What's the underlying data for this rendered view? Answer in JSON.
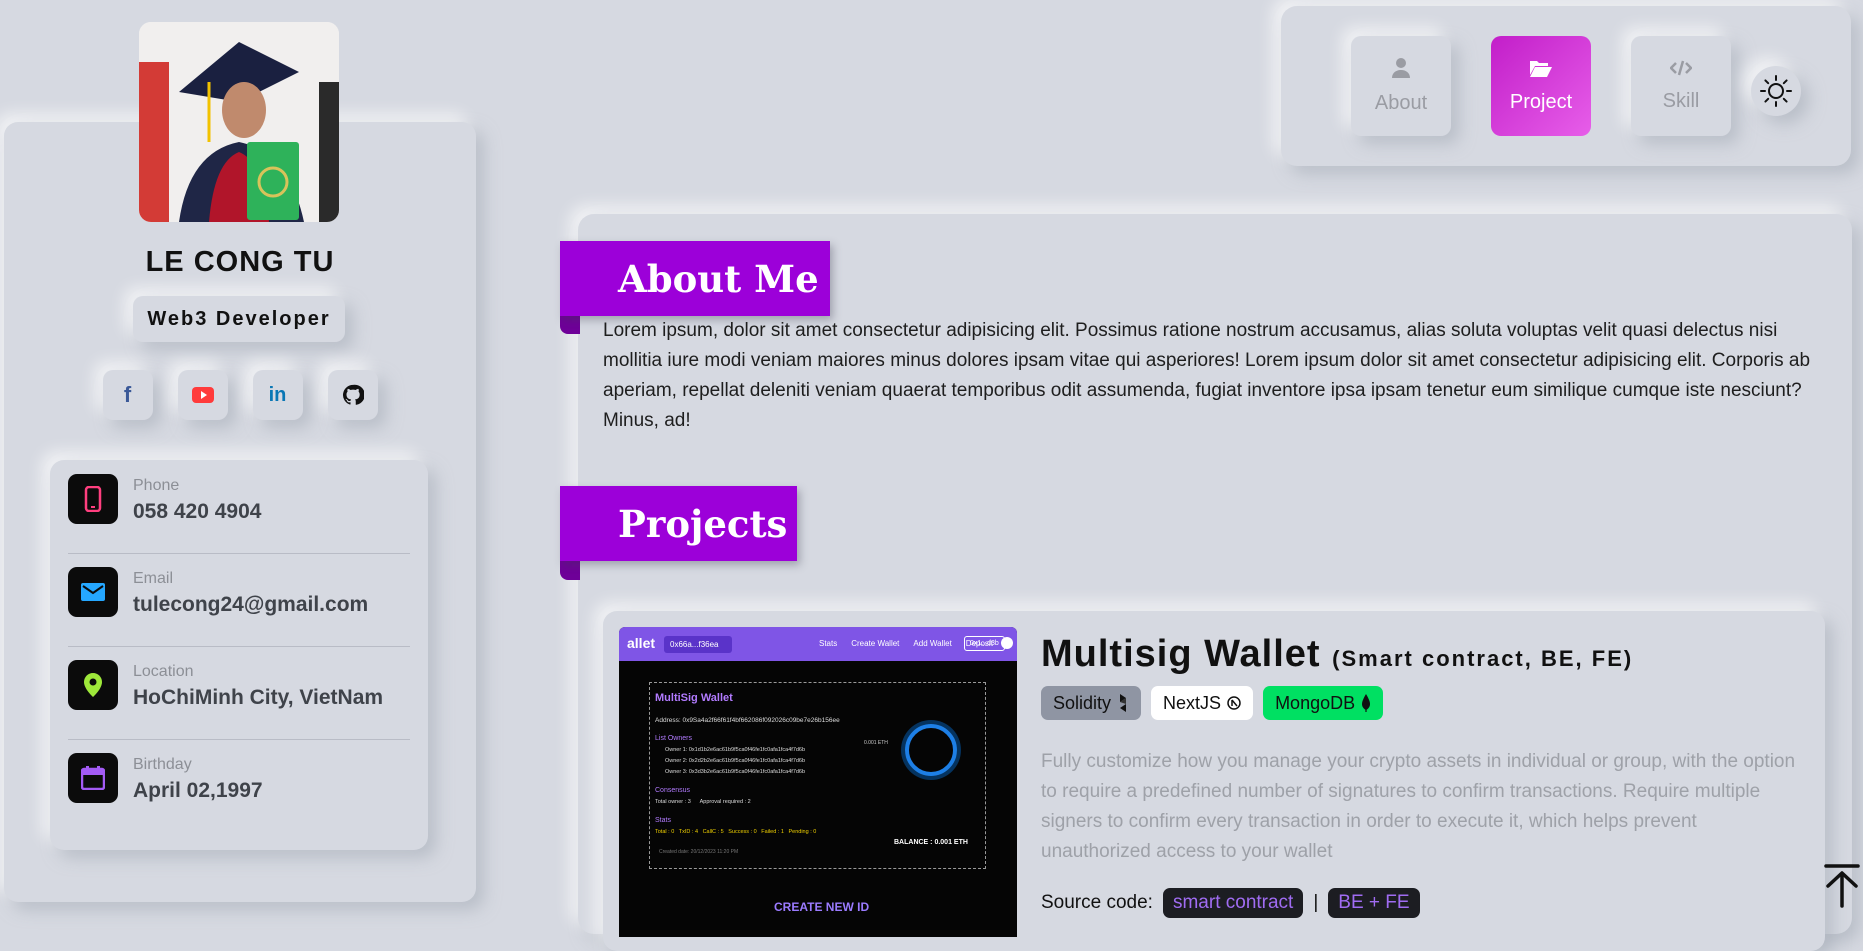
{
  "profile": {
    "name": "LE CONG TU",
    "role": "Web3 Developer"
  },
  "socials": [
    {
      "name": "facebook",
      "icon": "f",
      "color": "#3b5998"
    },
    {
      "name": "youtube",
      "icon": "youtube-icon",
      "color": "#ff3b3b"
    },
    {
      "name": "linkedin",
      "icon": "in",
      "color": "#0a77b5"
    },
    {
      "name": "github",
      "icon": "github-icon",
      "color": "#111111"
    }
  ],
  "contacts": [
    {
      "label": "Phone",
      "value": "058 420 4904",
      "icon": "phone-icon",
      "color": "#ff3f7f"
    },
    {
      "label": "Email",
      "value": "tulecong24@gmail.com",
      "icon": "mail-icon",
      "color": "#25a7ff"
    },
    {
      "label": "Location",
      "value": "HoChiMinh City, VietNam",
      "icon": "location-icon",
      "color": "#9ee83a"
    },
    {
      "label": "Birthday",
      "value": "April 02,1997",
      "icon": "calendar-icon",
      "color": "#a35bf5"
    }
  ],
  "nav": {
    "items": [
      {
        "label": "About",
        "icon": "user-icon",
        "active": false
      },
      {
        "label": "Project",
        "icon": "folder-open-icon",
        "active": true
      },
      {
        "label": "Skill",
        "icon": "code-icon",
        "active": false
      }
    ],
    "theme_icon": "sun-icon"
  },
  "about": {
    "heading": "About Me",
    "text": "Lorem ipsum, dolor sit amet consectetur adipisicing elit. Possimus ratione nostrum accusamus, alias soluta voluptas velit quasi delectus nisi mollitia iure modi veniam maiores minus dolores ipsam vitae qui asperiores! Lorem ipsum dolor sit amet consectetur adipisicing elit. Corporis ab aperiam, repellat deleniti veniam quaerat temporibus odit assumenda, fugiat inventore ipsa ipsam tenetur eum similique cumque iste nesciunt? Minus, ad!"
  },
  "projects": {
    "heading": "Projects",
    "items": [
      {
        "title": "Multisig Wallet",
        "subtitle": "(Smart contract, BE, FE)",
        "tags": [
          {
            "label": "Solidity",
            "icon": "solidity-icon",
            "bg": "#8f95a3",
            "fg": "#111111"
          },
          {
            "label": "NextJS",
            "icon": "nextjs-icon",
            "bg": "#ffffff",
            "fg": "#111111"
          },
          {
            "label": "MongoDB",
            "icon": "mongodb-leaf-icon",
            "bg": "#00e062",
            "fg": "#111111"
          }
        ],
        "description": "Fully customize how you manage your crypto assets in individual or group, with the option to require a predefined number of signatures to confirm transactions. Require multiple signers to confirm every transaction in order to execute it, which helps prevent unauthorized access to your wallet",
        "source_label": "Source code:",
        "source_links": [
          "smart contract",
          "BE + FE"
        ],
        "separator": "|",
        "screenshot": {
          "app_logo": "allet",
          "account": "0x66a...f36ea",
          "menu": [
            "Stats",
            "Create Wallet",
            "Add Wallet",
            "Deposit"
          ],
          "chip": "0x1...d3b",
          "panel_title": "MultiSig Wallet",
          "address": "Address: 0x9Sa4a2f66f61f4bf662086f092026c09be7e26b156ee",
          "list_owners": "List Owners",
          "owners": [
            "Owner 1: 0x1d1b2e6ac61b9f5ca0f46fe1fc0afa1fca4f7d6b",
            "Owner 2: 0x2d2b2e6ac61b9f5ca0f46fe1fc0afa1fca4f7d6b",
            "Owner 3: 0x3d3b2e6ac61b9f5ca0f46fe1fc0afa1fca4f7d6b"
          ],
          "consensus": "Consensus",
          "consensus_text": "Total owner : 3      Approval required : 2",
          "stats": "Stats",
          "stats_text": "Total : 0   TxID : 4   CallC : 5   Success : 0   Failed : 1   Pending : 0",
          "created": "Created date: 20/12/2023 11:20 PM",
          "circle_text": "0.001 ETH",
          "balance": "BALANCE : 0.001 ETH",
          "create_button": "CREATE NEW ID"
        }
      }
    ]
  }
}
